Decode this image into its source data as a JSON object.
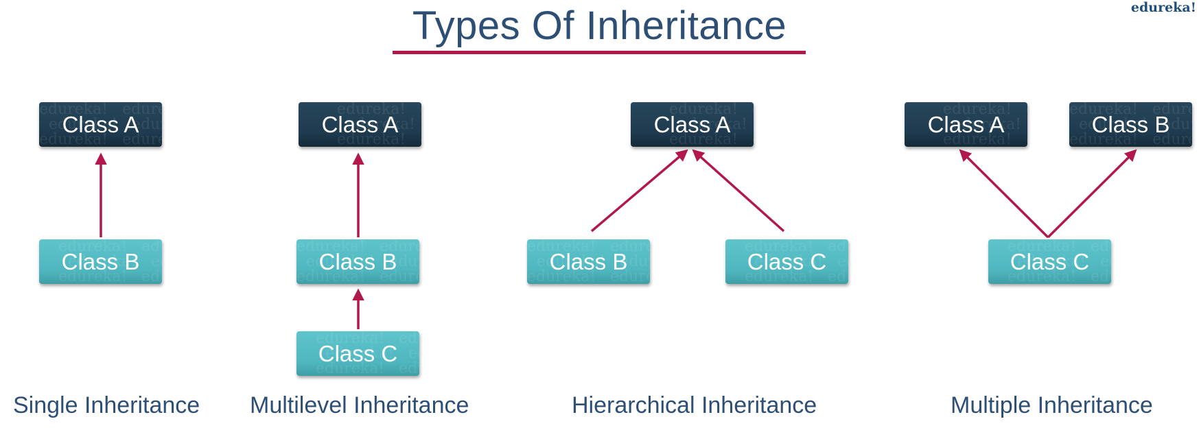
{
  "title": "Types Of Inheritance",
  "brand": "edureka!",
  "watermark": "edureka!",
  "colors": {
    "title": "#2e4f75",
    "accent": "#b2184a",
    "parent_box": "#1e3a4e",
    "child_box": "#4fb6bf"
  },
  "diagrams": [
    {
      "caption": "Single Inheritance",
      "classes": [
        "Class A",
        "Class B"
      ],
      "edges": [
        {
          "from": "Class B",
          "to": "Class A"
        }
      ]
    },
    {
      "caption": "Multilevel Inheritance",
      "classes": [
        "Class A",
        "Class B",
        "Class C"
      ],
      "edges": [
        {
          "from": "Class B",
          "to": "Class A"
        },
        {
          "from": "Class C",
          "to": "Class B"
        }
      ]
    },
    {
      "caption": "Hierarchical Inheritance",
      "classes": [
        "Class A",
        "Class B",
        "Class C"
      ],
      "edges": [
        {
          "from": "Class B",
          "to": "Class A"
        },
        {
          "from": "Class C",
          "to": "Class A"
        }
      ]
    },
    {
      "caption": "Multiple Inheritance",
      "classes": [
        "Class A",
        "Class B",
        "Class C"
      ],
      "edges": [
        {
          "from": "Class C",
          "to": "Class A"
        },
        {
          "from": "Class C",
          "to": "Class B"
        }
      ]
    }
  ]
}
